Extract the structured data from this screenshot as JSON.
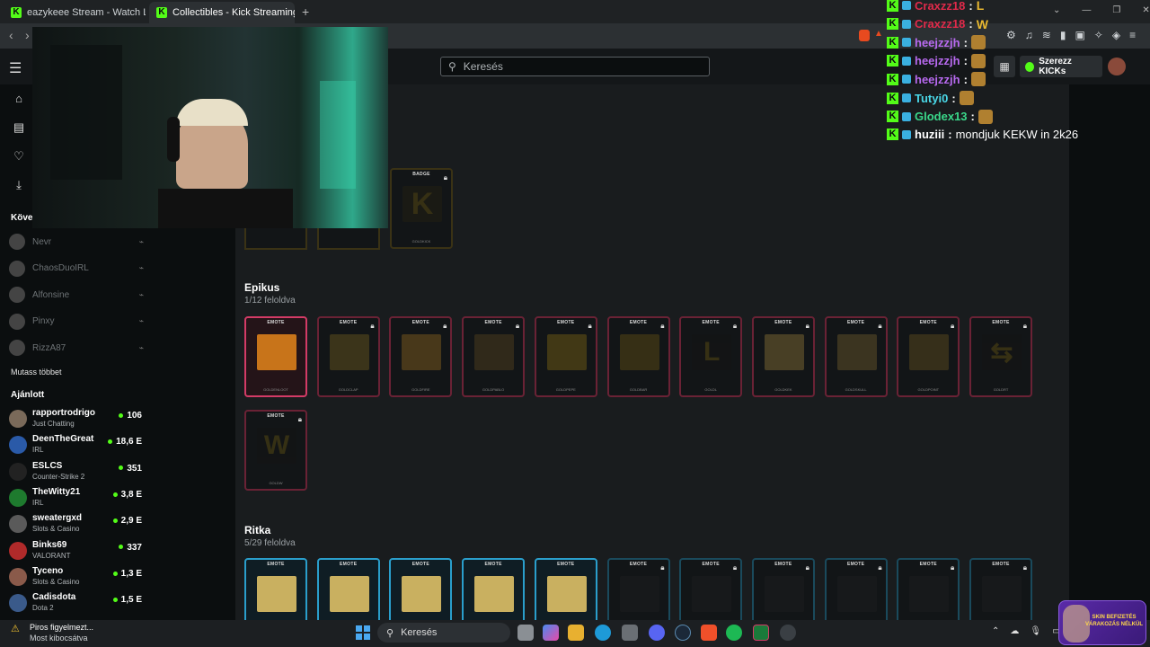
{
  "browser": {
    "tabs": [
      {
        "title": "eazykeee Stream - Watch Live on Kic"
      },
      {
        "title": "Collectibles - Kick Streaming"
      }
    ],
    "new_tab": "+",
    "window_controls": [
      "⌄",
      "—",
      "❐",
      "✕"
    ]
  },
  "header": {
    "search_placeholder": "Keresés",
    "get_kicks_label": "Szerezz KICKs"
  },
  "sidebar": {
    "following_heading": "Követ",
    "followed": [
      {
        "name": "Nevr"
      },
      {
        "name": "ChaosDuoIRL"
      },
      {
        "name": "Alfonsine"
      },
      {
        "name": "Pinxy"
      },
      {
        "name": "RizzA87"
      }
    ],
    "show_more": "Mutass többet",
    "recommended_heading": "Ajánlott",
    "recommended": [
      {
        "name": "rapportrodrigo",
        "category": "Just Chatting",
        "viewers": "106",
        "color": "#7a6a5a"
      },
      {
        "name": "DeenTheGreat",
        "category": "IRL",
        "viewers": "18,6 E",
        "color": "#2a5aa8"
      },
      {
        "name": "ESLCS",
        "category": "Counter-Strike 2",
        "viewers": "351",
        "color": "#222222"
      },
      {
        "name": "TheWitty21",
        "category": "IRL",
        "viewers": "3,8 E",
        "color": "#1e7a2e"
      },
      {
        "name": "sweatergxd",
        "category": "Slots & Casino",
        "viewers": "2,9 E",
        "color": "#5a5a5a"
      },
      {
        "name": "Binks69",
        "category": "VALORANT",
        "viewers": "337",
        "color": "#b02a2a"
      },
      {
        "name": "Tyceno",
        "category": "Slots & Casino",
        "viewers": "1,3 E",
        "color": "#8a5a4a"
      },
      {
        "name": "Cadisdota",
        "category": "Dota 2",
        "viewers": "1,5 E",
        "color": "#3a5a8a"
      }
    ]
  },
  "main": {
    "top_badges": [
      {
        "tag": "BADGE",
        "letter": "K",
        "name": "GOLDKICK"
      }
    ],
    "sections": [
      {
        "title": "Epikus",
        "subtitle": "1/12 feloldva",
        "items": [
          {
            "tag": "EMOTE",
            "name": "GOLDENLOOT",
            "unlocked": true,
            "letter": ""
          },
          {
            "tag": "EMOTE",
            "name": "GOLDCLAP",
            "unlocked": false,
            "letter": ""
          },
          {
            "tag": "EMOTE",
            "name": "GOLDFIRE",
            "unlocked": false,
            "letter": ""
          },
          {
            "tag": "EMOTE",
            "name": "GOLDPABLO",
            "unlocked": false,
            "letter": ""
          },
          {
            "tag": "EMOTE",
            "name": "GOLDPEPE",
            "unlocked": false,
            "letter": ""
          },
          {
            "tag": "EMOTE",
            "name": "GOLDBAR",
            "unlocked": false,
            "letter": ""
          },
          {
            "tag": "EMOTE",
            "name": "GOLDL",
            "unlocked": false,
            "letter": "L"
          },
          {
            "tag": "EMOTE",
            "name": "GOLDKEK",
            "unlocked": false,
            "letter": ""
          },
          {
            "tag": "EMOTE",
            "name": "GOLDSKULL",
            "unlocked": false,
            "letter": ""
          },
          {
            "tag": "EMOTE",
            "name": "GOLDPOINT",
            "unlocked": false,
            "letter": ""
          },
          {
            "tag": "EMOTE",
            "name": "GOLDRT",
            "unlocked": false,
            "letter": "⇆"
          },
          {
            "tag": "EMOTE",
            "name": "GOLDW",
            "unlocked": false,
            "letter": "W"
          }
        ]
      },
      {
        "title": "Ritka",
        "subtitle": "5/29 feloldva",
        "items": [
          {
            "tag": "EMOTE",
            "unlocked": true
          },
          {
            "tag": "EMOTE",
            "unlocked": true
          },
          {
            "tag": "EMOTE",
            "unlocked": true
          },
          {
            "tag": "EMOTE",
            "unlocked": true
          },
          {
            "tag": "EMOTE",
            "unlocked": true
          },
          {
            "tag": "EMOTE",
            "unlocked": false
          },
          {
            "tag": "EMOTE",
            "unlocked": false
          },
          {
            "tag": "EMOTE",
            "unlocked": false
          },
          {
            "tag": "EMOTE",
            "unlocked": false
          },
          {
            "tag": "EMOTE",
            "unlocked": false
          },
          {
            "tag": "EMOTE",
            "unlocked": false
          }
        ]
      }
    ]
  },
  "chat": [
    {
      "user": "Craxzz18",
      "color": "#e02a4a",
      "message": "",
      "emote": "L"
    },
    {
      "user": "Craxzz18",
      "color": "#e02a4a",
      "message": "",
      "emote": "W"
    },
    {
      "user": "heejzzjh",
      "color": "#b86af0",
      "message": "",
      "emote": ""
    },
    {
      "user": "heejzzjh",
      "color": "#b86af0",
      "message": "",
      "emote": ""
    },
    {
      "user": "heejzzjh",
      "color": "#b86af0",
      "message": "",
      "emote": ""
    },
    {
      "user": "Tutyi0",
      "color": "#4ad8e8",
      "message": "",
      "emote": ""
    },
    {
      "user": "Glodex13",
      "color": "#3ad88a",
      "message": "",
      "emote": ""
    },
    {
      "user": "huziii",
      "color": "#ffffff",
      "message": "mondjuk KEKW in 2k26",
      "emote": ""
    }
  ],
  "notification": {
    "title": "Piros figyelmezt...",
    "subtitle": "Most kibocsátva"
  },
  "taskbar": {
    "search_placeholder": "Keresés"
  },
  "corner_badge": "SKIN BEFIZETÉS VÁRAKOZÁS NÉLKÜL"
}
